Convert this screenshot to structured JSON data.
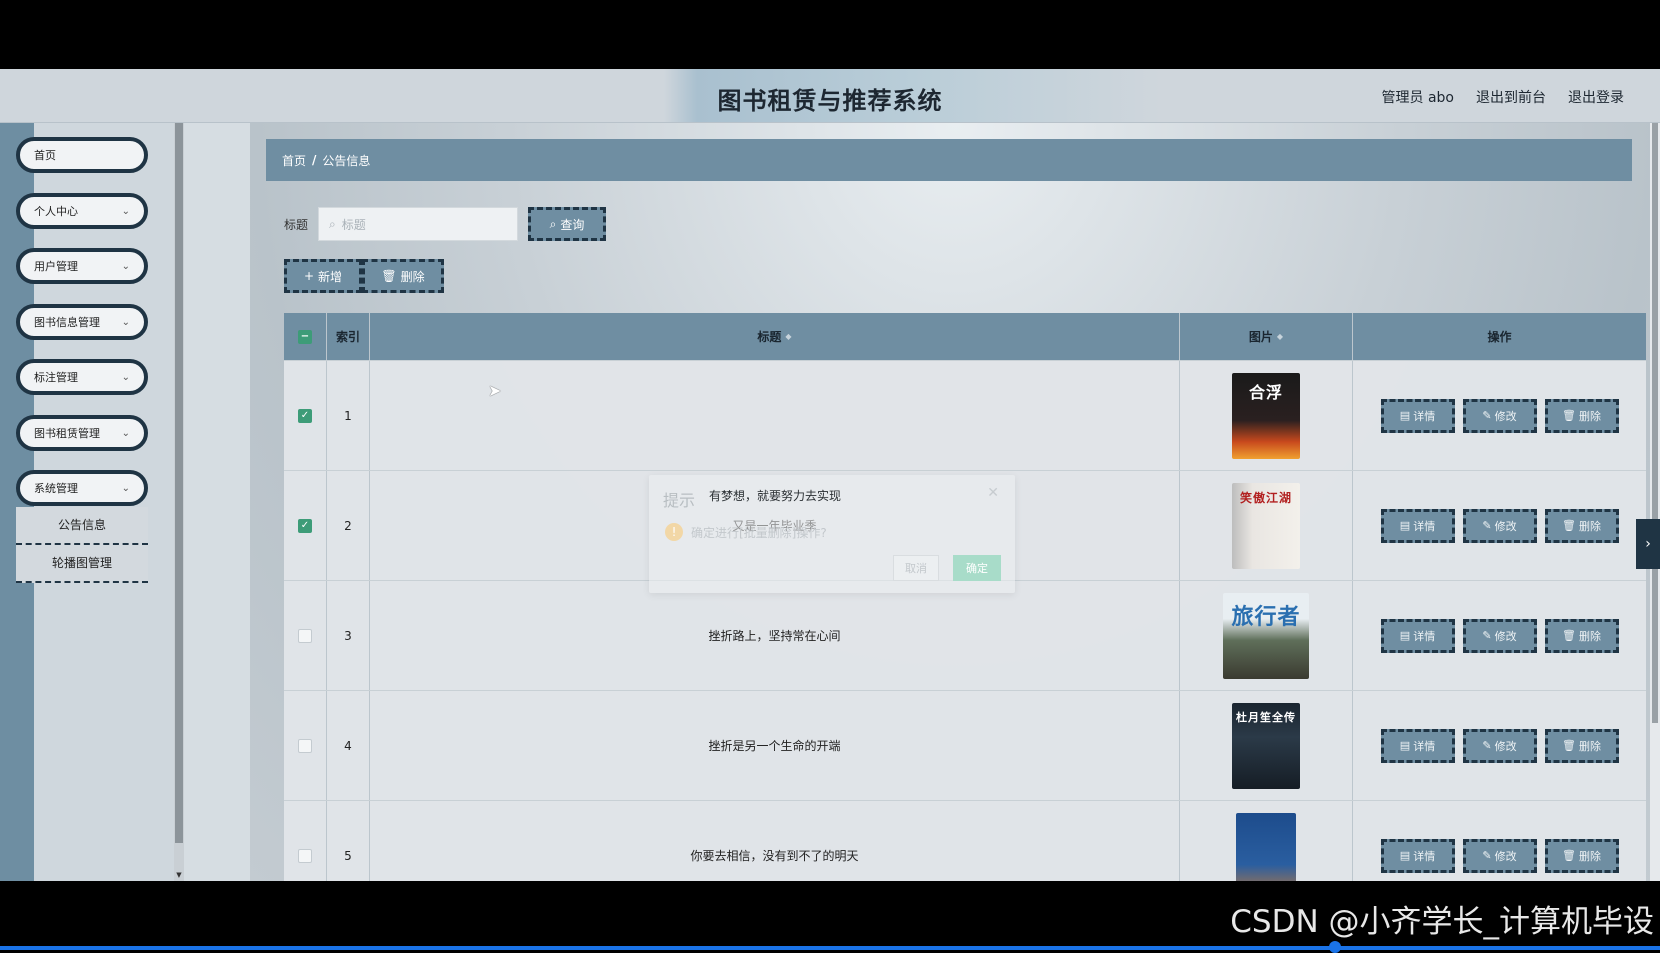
{
  "app": {
    "title": "图书租赁与推荐系统",
    "user_label": "管理员 abo",
    "back_to_front": "退出到前台",
    "logout": "退出登录"
  },
  "sidebar": {
    "items": [
      {
        "label": "首页"
      },
      {
        "label": "个人中心"
      },
      {
        "label": "用户管理"
      },
      {
        "label": "图书信息管理"
      },
      {
        "label": "标注管理"
      },
      {
        "label": "图书租赁管理"
      },
      {
        "label": "系统管理"
      }
    ],
    "sub_items": [
      {
        "label": "公告信息"
      },
      {
        "label": "轮播图管理"
      }
    ]
  },
  "breadcrumb": {
    "home": "首页",
    "sep": "/",
    "current": "公告信息"
  },
  "search": {
    "label": "标题",
    "placeholder": "标题",
    "button": "查询"
  },
  "actions": {
    "add": "新增",
    "delete": "删除"
  },
  "table": {
    "headers": {
      "index": "索引",
      "title": "标题",
      "image": "图片",
      "ops": "操作"
    },
    "rows": [
      {
        "index": "1",
        "title": "",
        "checked": true,
        "cover": "合浮"
      },
      {
        "index": "2",
        "title": "又是一年毕业季",
        "checked": true,
        "cover": "笑傲江湖"
      },
      {
        "index": "3",
        "title": "挫折路上，坚持常在心间",
        "checked": false,
        "cover": "旅行者"
      },
      {
        "index": "4",
        "title": "挫折是另一个生命的开端",
        "checked": false,
        "cover": "杜月笙全传"
      },
      {
        "index": "5",
        "title": "你要去相信，没有到不了的明天",
        "checked": false,
        "cover": ""
      }
    ],
    "op_labels": {
      "detail": "详情",
      "edit": "修改",
      "delete": "删除"
    }
  },
  "dialog": {
    "title": "提示",
    "overlay_text": "有梦想，就要努力去实现",
    "message": "确定进行[批量删除]操作?",
    "cancel": "取消",
    "confirm": "确定"
  },
  "watermark": "CSDN @小齐学长_计算机毕设",
  "colors": {
    "primary": "#6f8ea2",
    "dark_border": "#1f3444",
    "check_green": "#3d9c78"
  }
}
